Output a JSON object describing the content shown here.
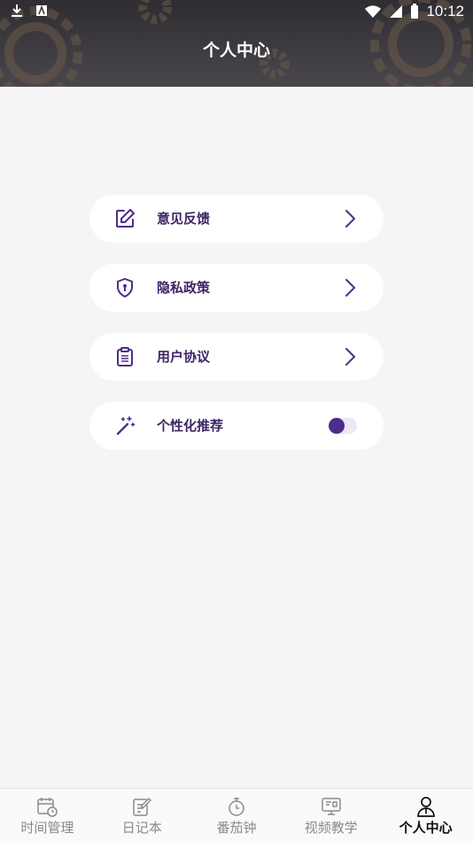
{
  "status_bar": {
    "time": "10:12",
    "left_icons": [
      "download-icon",
      "app-icon"
    ],
    "right_icons": [
      "wifi-icon",
      "signal-icon",
      "battery-icon"
    ]
  },
  "header": {
    "title": "个人中心"
  },
  "menu": {
    "items": [
      {
        "label": "意见反馈",
        "icon": "edit-icon"
      },
      {
        "label": "隐私政策",
        "icon": "shield-icon"
      },
      {
        "label": "用户协议",
        "icon": "clipboard-icon"
      },
      {
        "label": "个性化推荐",
        "icon": "magic-wand-icon",
        "toggle_on": true
      }
    ]
  },
  "tabbar": {
    "tabs": [
      {
        "label": "时间管理",
        "icon": "calendar-clock-icon",
        "active": false
      },
      {
        "label": "日记本",
        "icon": "diary-icon",
        "active": false
      },
      {
        "label": "番茄钟",
        "icon": "timer-icon",
        "active": false
      },
      {
        "label": "视频教学",
        "icon": "video-icon",
        "active": false
      },
      {
        "label": "个人中心",
        "icon": "person-icon",
        "active": true
      }
    ]
  },
  "colors": {
    "accent": "#4e2d8a",
    "menu_text": "#3e2466",
    "header_bg": "#3a373c"
  }
}
